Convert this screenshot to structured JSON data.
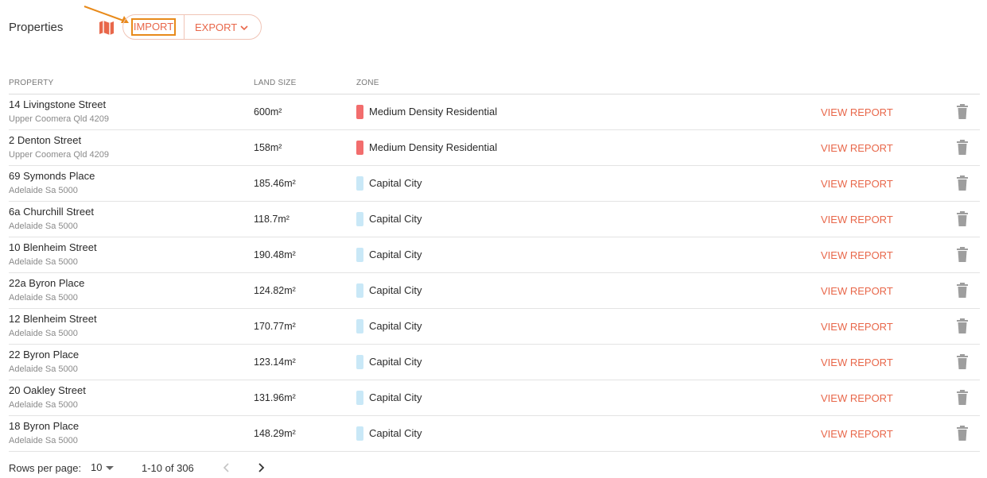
{
  "header": {
    "title": "Properties",
    "import_label": "IMPORT",
    "export_label": "EXPORT"
  },
  "table": {
    "headers": {
      "property": "PROPERTY",
      "land_size": "LAND SIZE",
      "zone": "ZONE"
    },
    "report_label": "VIEW REPORT",
    "rows": [
      {
        "street": "14 Livingstone Street",
        "suburb": "Upper Coomera Qld 4209",
        "land_size": "600m²",
        "zone": "Medium Density Residential",
        "zone_color": "#f26d6d"
      },
      {
        "street": "2 Denton Street",
        "suburb": "Upper Coomera Qld 4209",
        "land_size": "158m²",
        "zone": "Medium Density Residential",
        "zone_color": "#f26d6d"
      },
      {
        "street": "69 Symonds Place",
        "suburb": "Adelaide Sa 5000",
        "land_size": "185.46m²",
        "zone": "Capital City",
        "zone_color": "#c9e8f7"
      },
      {
        "street": "6a Churchill Street",
        "suburb": "Adelaide Sa 5000",
        "land_size": "118.7m²",
        "zone": "Capital City",
        "zone_color": "#c9e8f7"
      },
      {
        "street": "10 Blenheim Street",
        "suburb": "Adelaide Sa 5000",
        "land_size": "190.48m²",
        "zone": "Capital City",
        "zone_color": "#c9e8f7"
      },
      {
        "street": "22a Byron Place",
        "suburb": "Adelaide Sa 5000",
        "land_size": "124.82m²",
        "zone": "Capital City",
        "zone_color": "#c9e8f7"
      },
      {
        "street": "12 Blenheim Street",
        "suburb": "Adelaide Sa 5000",
        "land_size": "170.77m²",
        "zone": "Capital City",
        "zone_color": "#c9e8f7"
      },
      {
        "street": "22 Byron Place",
        "suburb": "Adelaide Sa 5000",
        "land_size": "123.14m²",
        "zone": "Capital City",
        "zone_color": "#c9e8f7"
      },
      {
        "street": "20 Oakley Street",
        "suburb": "Adelaide Sa 5000",
        "land_size": "131.96m²",
        "zone": "Capital City",
        "zone_color": "#c9e8f7"
      },
      {
        "street": "18 Byron Place",
        "suburb": "Adelaide Sa 5000",
        "land_size": "148.29m²",
        "zone": "Capital City",
        "zone_color": "#c9e8f7"
      }
    ]
  },
  "pagination": {
    "rows_per_page_label": "Rows per page:",
    "rows_per_page": "10",
    "range": "1-10 of 306"
  },
  "colors": {
    "accent": "#e8674a",
    "highlight": "#e88a1a"
  },
  "icons": {
    "map": "map-icon",
    "trash": "trash-icon",
    "chevron": "chevron-down-icon",
    "prev": "chevron-left-icon",
    "next": "chevron-right-icon"
  }
}
